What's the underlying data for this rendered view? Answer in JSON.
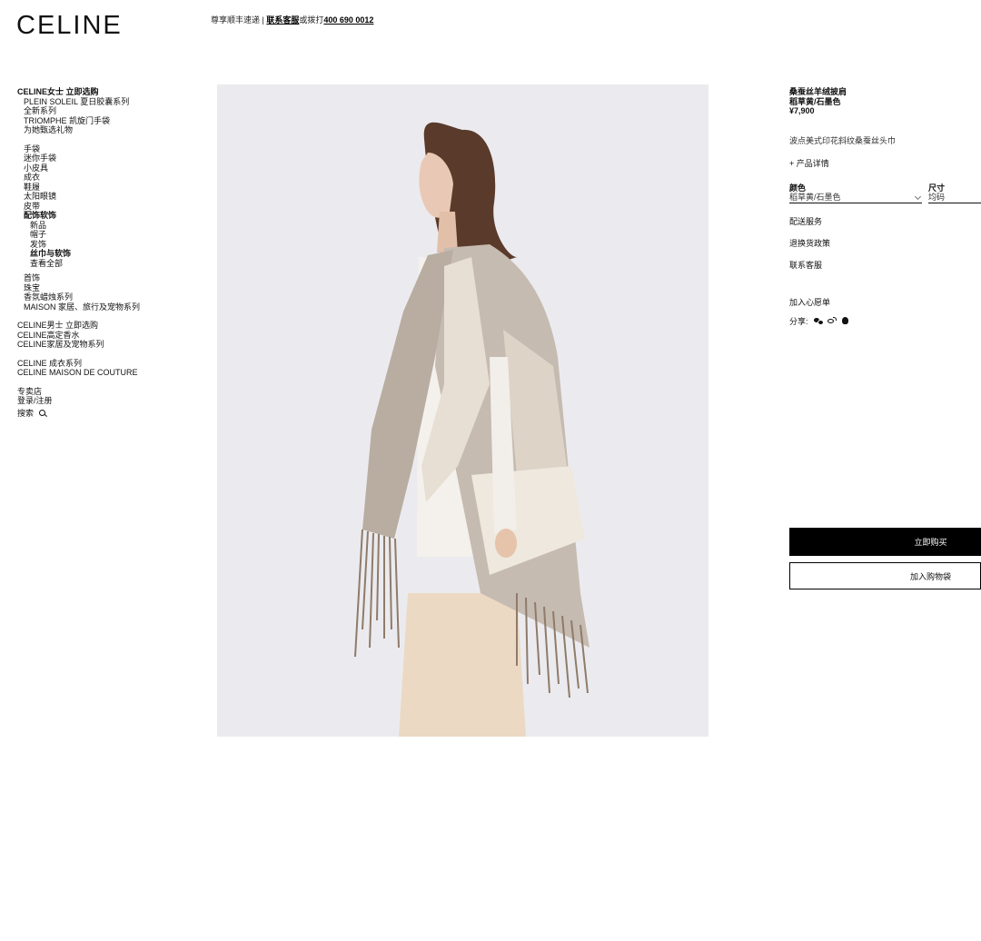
{
  "header": {
    "logo": "CELINE",
    "promo_text": "尊享顺丰速递 | ",
    "contact_link": "联系客服",
    "phone_prefix": "或拨打",
    "phone": "400 690 0012"
  },
  "nav": {
    "women_title": "CELINE女士 立即选购",
    "collections": [
      "PLEIN SOLEIL 夏日胶囊系列",
      "全新系列",
      "TRIOMPHE 凯旋门手袋",
      "为她甄选礼物"
    ],
    "categories": [
      "手袋",
      "迷你手袋",
      "小皮具",
      "成衣",
      "鞋履",
      "太阳眼镜",
      "皮带"
    ],
    "accessories_title": "配饰软饰",
    "accessories": [
      "新品",
      "帽子",
      "发饰",
      "丝巾与软饰",
      "查看全部"
    ],
    "more": [
      "首饰",
      "珠宝",
      "香氛蜡烛系列",
      "MAISON 家居、旅行及宠物系列"
    ],
    "links_a": [
      "CELINE男士 立即选购",
      "CELINE高定香水",
      "CELINE家居及宠物系列"
    ],
    "links_b": [
      "CELINE 成衣系列",
      "CELINE MAISON DE COUTURE"
    ],
    "links_c": [
      "专卖店",
      "登录/注册"
    ],
    "search_label": "搜索"
  },
  "product": {
    "name": "桑蚕丝羊绒披肩",
    "color_line": "稻草黄/石墨色",
    "price": "¥7,900",
    "description": "波点美式印花斜纹桑蚕丝头巾",
    "details_toggle": "+ 产品详情",
    "color_label": "颜色",
    "color_value": "稻草黄/石墨色",
    "size_label": "尺寸",
    "size_value": "均码",
    "delivery": "配送服务",
    "returns": "退换货政策",
    "contact": "联系客服",
    "wishlist": "加入心愿单",
    "share_label": "分享:",
    "buy_now": "立即购买",
    "add_to_bag": "加入购物袋"
  },
  "colors": {
    "photo_background": "#ebebef",
    "cape_main": "#c3b7ac",
    "cape_light": "#e9e0d4",
    "fringe": "#8f7b6a",
    "hair": "#5a3a2a"
  }
}
